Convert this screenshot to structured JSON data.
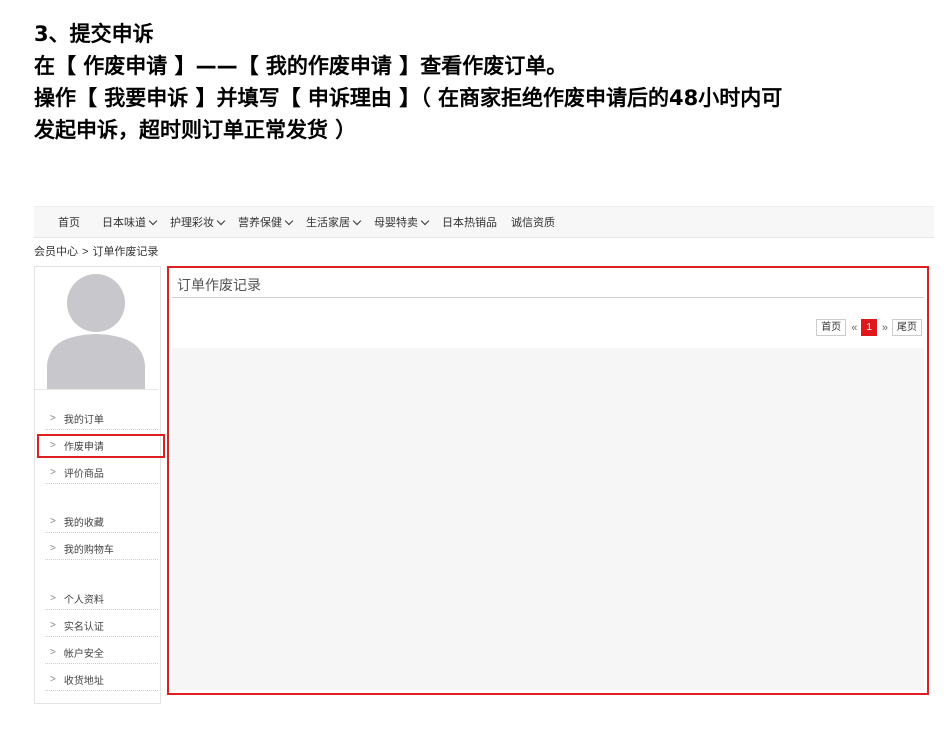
{
  "instructions": {
    "step_title": "3、提交申诉",
    "line1": "在【 作废申请 】——【 我的作废申请 】查看作废订单。",
    "line2": "操作【 我要申诉 】并填写【 申诉理由 】（ 在商家拒绝作废申请后的48小时内可",
    "line3": "发起申诉，超时则订单正常发货 ）"
  },
  "nav": {
    "items": [
      {
        "label": "首页",
        "dropdown": false
      },
      {
        "label": "日本味道",
        "dropdown": true
      },
      {
        "label": "护理彩妆",
        "dropdown": true
      },
      {
        "label": "营养保健",
        "dropdown": true
      },
      {
        "label": "生活家居",
        "dropdown": true
      },
      {
        "label": "母婴特卖",
        "dropdown": true
      },
      {
        "label": "日本热销品",
        "dropdown": false
      },
      {
        "label": "诚信资质",
        "dropdown": false
      }
    ]
  },
  "breadcrumb": {
    "home": "会员中心",
    "separator": ">",
    "current": "订单作废记录"
  },
  "sidebar": {
    "menu": [
      "我的订单",
      "作废申请",
      "评价商品",
      "我的收藏",
      "我的购物车",
      "个人资料",
      "实名认证",
      "帐户安全",
      "收货地址"
    ],
    "highlighted": "作废申请"
  },
  "main": {
    "title": "订单作废记录",
    "pager": {
      "first": "首页",
      "prev": "«",
      "current": "1",
      "next": "»",
      "last": "尾页"
    }
  },
  "colors": {
    "highlight": "#e02020",
    "page_current": "#e0181b"
  }
}
